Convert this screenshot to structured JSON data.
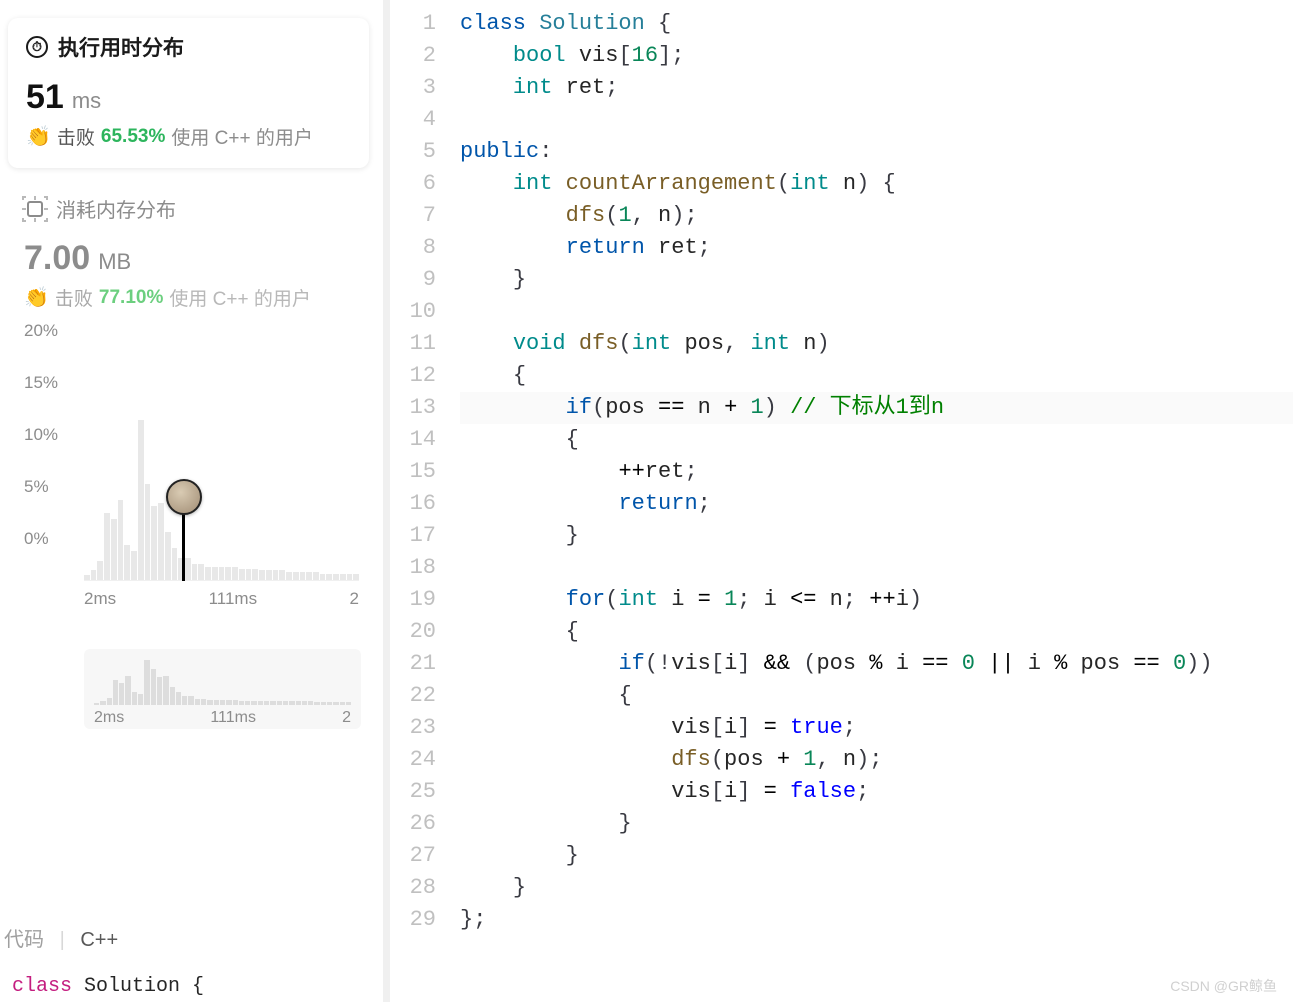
{
  "runtime_card": {
    "title": "执行用时分布",
    "value": "51",
    "unit": "ms",
    "beat_label": "击败",
    "beat_pct": "65.53%",
    "beat_suffix": "使用 C++ 的用户"
  },
  "memory_section": {
    "title": "消耗内存分布",
    "value": "7.00",
    "unit": "MB",
    "beat_label": "击败",
    "beat_pct": "77.10%",
    "beat_suffix": "使用 C++ 的用户"
  },
  "chart_data": {
    "type": "bar",
    "ylabel": "percent",
    "y_ticks": [
      "20%",
      "15%",
      "10%",
      "5%",
      "0%"
    ],
    "x_ticks_main": [
      "2ms",
      "111ms",
      "2"
    ],
    "x_ticks_mini": [
      "2ms",
      "111ms",
      "2"
    ],
    "main_bars_pct": [
      3,
      6,
      12,
      42,
      38,
      50,
      22,
      18,
      100,
      60,
      46,
      48,
      30,
      20,
      14,
      14,
      10,
      10,
      8,
      8,
      8,
      8,
      8,
      7,
      7,
      7,
      6,
      6,
      6,
      6,
      5,
      5,
      5,
      5,
      5,
      4,
      4,
      4,
      4,
      4,
      4
    ],
    "marker_bin_index": 8,
    "marker_value_ms": 51,
    "mini_bars_pct": [
      4,
      8,
      16,
      55,
      50,
      65,
      30,
      24,
      100,
      80,
      62,
      64,
      40,
      28,
      20,
      20,
      14,
      14,
      12,
      12,
      12,
      12,
      12,
      10,
      10,
      10,
      9,
      9,
      9,
      9,
      8,
      8,
      8,
      8,
      8,
      7,
      7,
      7,
      7,
      7,
      7
    ]
  },
  "bottom": {
    "left_label": "代码",
    "language": "C++",
    "snippet_prefix": "class",
    "snippet_rest": " Solution {"
  },
  "code": {
    "lines": [
      [
        [
          "t-kw",
          "class"
        ],
        [
          "",
          " "
        ],
        [
          "t-cls",
          "Solution"
        ],
        [
          "",
          " "
        ],
        [
          "t-punc",
          "{"
        ]
      ],
      [
        [
          "",
          "    "
        ],
        [
          "t-type",
          "bool"
        ],
        [
          "",
          " vis"
        ],
        [
          "t-punc",
          "["
        ],
        [
          "t-num",
          "16"
        ],
        [
          "t-punc",
          "];"
        ]
      ],
      [
        [
          "",
          "    "
        ],
        [
          "t-type",
          "int"
        ],
        [
          "",
          " ret"
        ],
        [
          "t-punc",
          ";"
        ]
      ],
      [
        [
          "",
          ""
        ]
      ],
      [
        [
          "t-kw",
          "public"
        ],
        [
          "t-punc",
          ":"
        ]
      ],
      [
        [
          "",
          "    "
        ],
        [
          "t-type",
          "int"
        ],
        [
          "",
          " "
        ],
        [
          "t-fn",
          "countArrangement"
        ],
        [
          "t-punc",
          "("
        ],
        [
          "t-type",
          "int"
        ],
        [
          "",
          " n"
        ],
        [
          "t-punc",
          ")"
        ],
        [
          "",
          " "
        ],
        [
          "t-punc",
          "{"
        ]
      ],
      [
        [
          "",
          "        "
        ],
        [
          "t-fn",
          "dfs"
        ],
        [
          "t-punc",
          "("
        ],
        [
          "t-num",
          "1"
        ],
        [
          "t-punc",
          ","
        ],
        [
          "",
          " n"
        ],
        [
          "t-punc",
          ");"
        ]
      ],
      [
        [
          "",
          "        "
        ],
        [
          "t-kw",
          "return"
        ],
        [
          "",
          " ret"
        ],
        [
          "t-punc",
          ";"
        ]
      ],
      [
        [
          "",
          "    "
        ],
        [
          "t-punc",
          "}"
        ]
      ],
      [
        [
          "",
          ""
        ]
      ],
      [
        [
          "",
          "    "
        ],
        [
          "t-type",
          "void"
        ],
        [
          "",
          " "
        ],
        [
          "t-fn",
          "dfs"
        ],
        [
          "t-punc",
          "("
        ],
        [
          "t-type",
          "int"
        ],
        [
          "",
          " pos"
        ],
        [
          "t-punc",
          ","
        ],
        [
          "",
          " "
        ],
        [
          "t-type",
          "int"
        ],
        [
          "",
          " n"
        ],
        [
          "t-punc",
          ")"
        ]
      ],
      [
        [
          "",
          "    "
        ],
        [
          "t-punc",
          "{"
        ]
      ],
      [
        [
          "",
          "        "
        ],
        [
          "t-kw",
          "if"
        ],
        [
          "t-punc",
          "("
        ],
        [
          "",
          "pos "
        ],
        [
          "t-op",
          "=="
        ],
        [
          "",
          " n "
        ],
        [
          "t-op",
          "+"
        ],
        [
          "",
          " "
        ],
        [
          "t-num",
          "1"
        ],
        [
          "t-punc",
          ")"
        ],
        [
          "",
          " "
        ],
        [
          "t-comment",
          "// 下标从1到n"
        ]
      ],
      [
        [
          "",
          "        "
        ],
        [
          "t-punc",
          "{"
        ]
      ],
      [
        [
          "",
          "            "
        ],
        [
          "t-op",
          "++"
        ],
        [
          "",
          "ret"
        ],
        [
          "t-punc",
          ";"
        ]
      ],
      [
        [
          "",
          "            "
        ],
        [
          "t-kw",
          "return"
        ],
        [
          "t-punc",
          ";"
        ]
      ],
      [
        [
          "",
          "        "
        ],
        [
          "t-punc",
          "}"
        ]
      ],
      [
        [
          "",
          ""
        ]
      ],
      [
        [
          "",
          "        "
        ],
        [
          "t-kw",
          "for"
        ],
        [
          "t-punc",
          "("
        ],
        [
          "t-type",
          "int"
        ],
        [
          "",
          " i "
        ],
        [
          "t-op",
          "="
        ],
        [
          "",
          " "
        ],
        [
          "t-num",
          "1"
        ],
        [
          "t-punc",
          ";"
        ],
        [
          "",
          " i "
        ],
        [
          "t-op",
          "<="
        ],
        [
          "",
          " n"
        ],
        [
          "t-punc",
          ";"
        ],
        [
          "",
          " "
        ],
        [
          "t-op",
          "++"
        ],
        [
          "",
          "i"
        ],
        [
          "t-punc",
          ")"
        ]
      ],
      [
        [
          "",
          "        "
        ],
        [
          "t-punc",
          "{"
        ]
      ],
      [
        [
          "",
          "            "
        ],
        [
          "t-kw",
          "if"
        ],
        [
          "t-punc",
          "(!"
        ],
        [
          "",
          "vis"
        ],
        [
          "t-punc",
          "["
        ],
        [
          "",
          "i"
        ],
        [
          "t-punc",
          "]"
        ],
        [
          "",
          " "
        ],
        [
          "t-op",
          "&&"
        ],
        [
          "",
          " "
        ],
        [
          "t-punc",
          "("
        ],
        [
          "",
          "pos "
        ],
        [
          "t-op",
          "%"
        ],
        [
          "",
          " i "
        ],
        [
          "t-op",
          "=="
        ],
        [
          "",
          " "
        ],
        [
          "t-num",
          "0"
        ],
        [
          "",
          " "
        ],
        [
          "t-op",
          "||"
        ],
        [
          "",
          " i "
        ],
        [
          "t-op",
          "%"
        ],
        [
          "",
          " pos "
        ],
        [
          "t-op",
          "=="
        ],
        [
          "",
          " "
        ],
        [
          "t-num",
          "0"
        ],
        [
          "t-punc",
          "))"
        ]
      ],
      [
        [
          "",
          "            "
        ],
        [
          "t-punc",
          "{"
        ]
      ],
      [
        [
          "",
          "                vis"
        ],
        [
          "t-punc",
          "["
        ],
        [
          "",
          "i"
        ],
        [
          "t-punc",
          "]"
        ],
        [
          "",
          " "
        ],
        [
          "t-op",
          "="
        ],
        [
          "",
          " "
        ],
        [
          "t-const",
          "true"
        ],
        [
          "t-punc",
          ";"
        ]
      ],
      [
        [
          "",
          "                "
        ],
        [
          "t-fn",
          "dfs"
        ],
        [
          "t-punc",
          "("
        ],
        [
          "",
          "pos "
        ],
        [
          "t-op",
          "+"
        ],
        [
          "",
          " "
        ],
        [
          "t-num",
          "1"
        ],
        [
          "t-punc",
          ","
        ],
        [
          "",
          " n"
        ],
        [
          "t-punc",
          ");"
        ]
      ],
      [
        [
          "",
          "                vis"
        ],
        [
          "t-punc",
          "["
        ],
        [
          "",
          "i"
        ],
        [
          "t-punc",
          "]"
        ],
        [
          "",
          " "
        ],
        [
          "t-op",
          "="
        ],
        [
          "",
          " "
        ],
        [
          "t-const",
          "false"
        ],
        [
          "t-punc",
          ";"
        ]
      ],
      [
        [
          "",
          "            "
        ],
        [
          "t-punc",
          "}"
        ]
      ],
      [
        [
          "",
          "        "
        ],
        [
          "t-punc",
          "}"
        ]
      ],
      [
        [
          "",
          "    "
        ],
        [
          "t-punc",
          "}"
        ]
      ],
      [
        [
          "t-punc",
          "};"
        ]
      ]
    ],
    "highlight_line": 13
  },
  "watermark": "CSDN @GR鲸鱼"
}
